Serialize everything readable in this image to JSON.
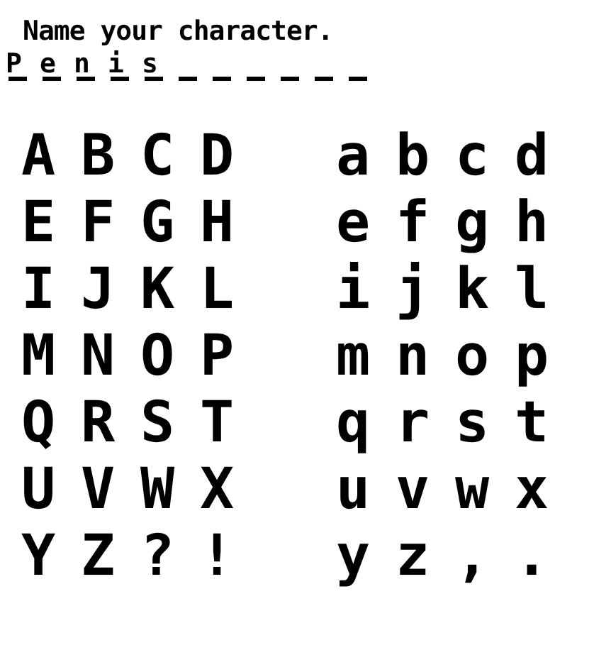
{
  "prompt": "Name your character.",
  "slots": [
    {
      "kind": "letter",
      "char": "P"
    },
    {
      "kind": "letter",
      "char": "e"
    },
    {
      "kind": "letter",
      "char": "n"
    },
    {
      "kind": "letter",
      "char": "i"
    },
    {
      "kind": "letter",
      "char": "s"
    },
    {
      "kind": "blank"
    },
    {
      "kind": "blank"
    },
    {
      "kind": "blank"
    },
    {
      "kind": "blank"
    },
    {
      "kind": "blank"
    },
    {
      "kind": "blank"
    }
  ],
  "uppercase": [
    [
      "A",
      "B",
      "C",
      "D"
    ],
    [
      "E",
      "F",
      "G",
      "H"
    ],
    [
      "I",
      "J",
      "K",
      "L"
    ],
    [
      "M",
      "N",
      "O",
      "P"
    ],
    [
      "Q",
      "R",
      "S",
      "T"
    ],
    [
      "U",
      "V",
      "W",
      "X"
    ],
    [
      "Y",
      "Z",
      "?",
      "!"
    ]
  ],
  "lowercase": [
    [
      "a",
      "b",
      "c",
      "d"
    ],
    [
      "e",
      "f",
      "g",
      "h"
    ],
    [
      "i",
      "j",
      "k",
      "l"
    ],
    [
      "m",
      "n",
      "o",
      "p"
    ],
    [
      "q",
      "r",
      "s",
      "t"
    ],
    [
      "u",
      "v",
      "w",
      "x"
    ],
    [
      "y",
      "z",
      ",",
      "."
    ]
  ]
}
